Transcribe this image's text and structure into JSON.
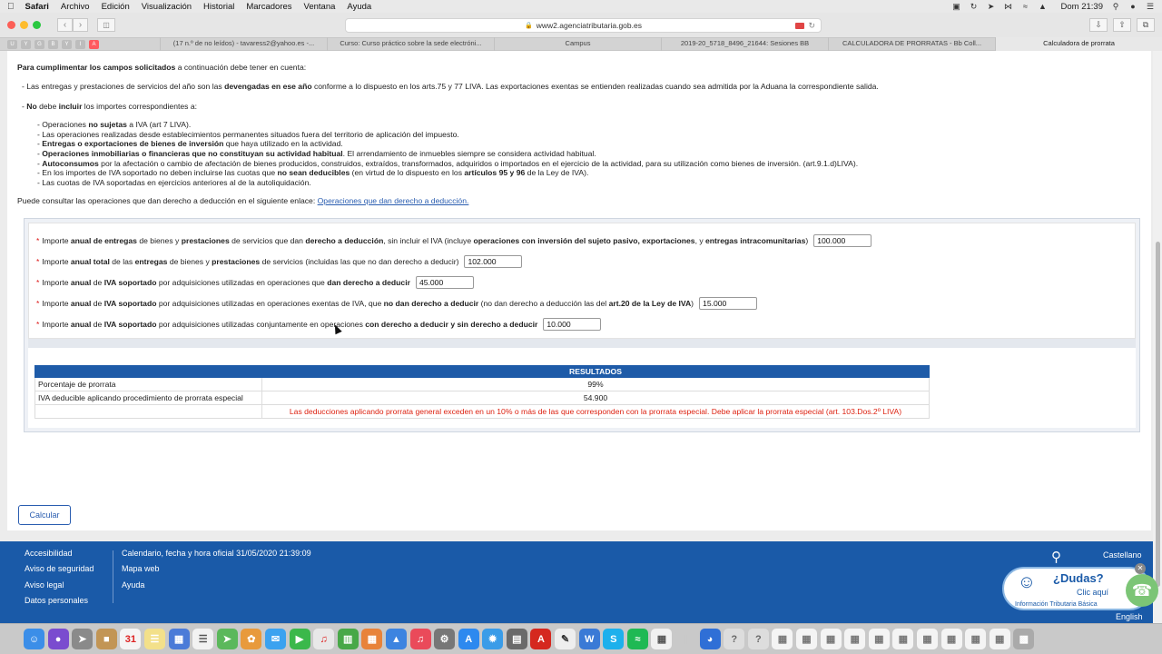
{
  "menubar": {
    "app": "Safari",
    "items": [
      "Archivo",
      "Edición",
      "Visualización",
      "Historial",
      "Marcadores",
      "Ventana",
      "Ayuda"
    ],
    "clock": "Dom 21:39"
  },
  "toolbar": {
    "url": "www2.agenciatributaria.gob.es"
  },
  "tabs": [
    "(17 n.º de no leídos) - tavaress2@yahoo.es -...",
    "Curso: Curso práctico sobre la sede electróni...",
    "Campus",
    "2019-20_5718_8496_21644: Sesiones BB",
    "CALCULADORA DE PRORRATAS - Bb Coll...",
    "Calculadora de prorrata"
  ],
  "intro": {
    "heading_bold": "Para cumplimentar los campos solicitados",
    "heading_rest": " a continuación debe tener en cuenta:",
    "p1_a": "- Las entregas y prestaciones de servicios del año son las ",
    "p1_b": "devengadas en ese año",
    "p1_c": " conforme a lo dispuesto en los arts.75 y 77 LIVA. Las exportaciones exentas se entienden realizadas cuando sea admitida por la Aduana la correspondiente salida.",
    "p2_a": "- ",
    "p2_b": "No",
    "p2_c": " debe ",
    "p2_d": "incluir",
    "p2_e": " los importes correspondientes a:",
    "b1_a": "- Operaciones ",
    "b1_b": "no sujetas",
    "b1_c": " a IVA (art 7 LIVA).",
    "b2": "- Las operaciones realizadas desde establecimientos permanentes situados fuera del territorio de aplicación del impuesto.",
    "b3_a": "- ",
    "b3_b": "Entregas o exportaciones de bienes de inversión",
    "b3_c": " que haya utilizado en la actividad.",
    "b4_a": "- ",
    "b4_b": "Operaciones inmobiliarias o financieras que no constituyan su actividad habitual",
    "b4_c": ". El arrendamiento de inmuebles siempre se considera actividad habitual.",
    "b5_a": "- ",
    "b5_b": "Autoconsumos",
    "b5_c": " por la afectación o cambio de afectación de bienes producidos, construidos, extraídos, transformados, adquiridos o importados en el ejercicio de la actividad, para su utilización como bienes de inversión. (art.9.1.d)LIVA).",
    "b6_a": "- En los importes de IVA soportado no deben incluirse las cuotas que ",
    "b6_b": "no sean deducibles",
    "b6_c": " (en virtud de lo dispuesto en los ",
    "b6_d": "artículos 95 y 96",
    "b6_e": " de la Ley de IVA).",
    "b7": "- Las cuotas de IVA soportadas en ejercicios anteriores al de la autoliquidación.",
    "link_text": "Puede consultar las operaciones que dan derecho a deducción en el siguiente enlace: ",
    "link": "Operaciones que dan derecho a deducción."
  },
  "form": {
    "f1": {
      "t1": "Importe ",
      "b1": "anual de entregas",
      "t2": " de bienes y ",
      "b2": "prestaciones",
      "t3": " de servicios que dan ",
      "b3": "derecho a deducción",
      "t4": ", sin incluir el IVA (incluye ",
      "b4": "operaciones con inversión del sujeto pasivo, exportaciones",
      "t5": ", y ",
      "b5": "entregas intracomunitarias",
      "t6": ")",
      "value": "100.000"
    },
    "f2": {
      "t1": "Importe ",
      "b1": "anual total",
      "t2": " de las ",
      "b2": "entregas",
      "t3": " de bienes y ",
      "b3": "prestaciones",
      "t4": " de servicios (incluidas las que no dan derecho a deducir)",
      "value": "102.000"
    },
    "f3": {
      "t1": "Importe ",
      "b1": "anual",
      "t2": " de ",
      "b2": "IVA soportado",
      "t3": " por adquisiciones utilizadas en operaciones que ",
      "b3": "dan derecho a deducir",
      "value": "45.000"
    },
    "f4": {
      "t1": "Importe ",
      "b1": "anual",
      "t2": " de ",
      "b2": "IVA soportado",
      "t3": " por adquisiciones utilizadas en operaciones exentas de IVA, que ",
      "b3": "no dan derecho a deducir",
      "t4": " (no dan derecho a deducción las del ",
      "b4": "art.20 de la Ley de IVA",
      "t5": ")",
      "value": "15.000"
    },
    "f5": {
      "t1": "Importe ",
      "b1": "anual",
      "t2": " de ",
      "b2": "IVA soportado",
      "t3": " por adquisiciones utilizadas conjuntamente en operaciones ",
      "b3": "con derecho a deducir y sin derecho a deducir",
      "value": "10.000"
    },
    "required_mark": "*"
  },
  "results": {
    "header": "RESULTADOS",
    "rows": [
      {
        "label": "Porcentaje de prorrata",
        "value": "99%"
      },
      {
        "label": "IVA deducible aplicando procedimiento de prorrata especial",
        "value": "54.900"
      }
    ],
    "warning": "Las deducciones aplicando prorrata general exceden en un 10% o más de las que corresponden con la prorrata especial. Debe aplicar la prorrata especial (art. 103.Dos.2º LIVA)"
  },
  "calc_button": "Calcular",
  "footer": {
    "col1": [
      "Accesibilidad",
      "Aviso de seguridad",
      "Aviso legal",
      "Datos personales"
    ],
    "col2": [
      "Calendario, fecha y hora oficial 31/05/2020 21:39:09",
      "Mapa web",
      "Ayuda"
    ],
    "lang1": "Castellano",
    "lang2": "English",
    "dudas_q": "¿Dudas?",
    "dudas_clic": "Clic aquí",
    "dudas_info": "Información Tributaria Básica"
  }
}
